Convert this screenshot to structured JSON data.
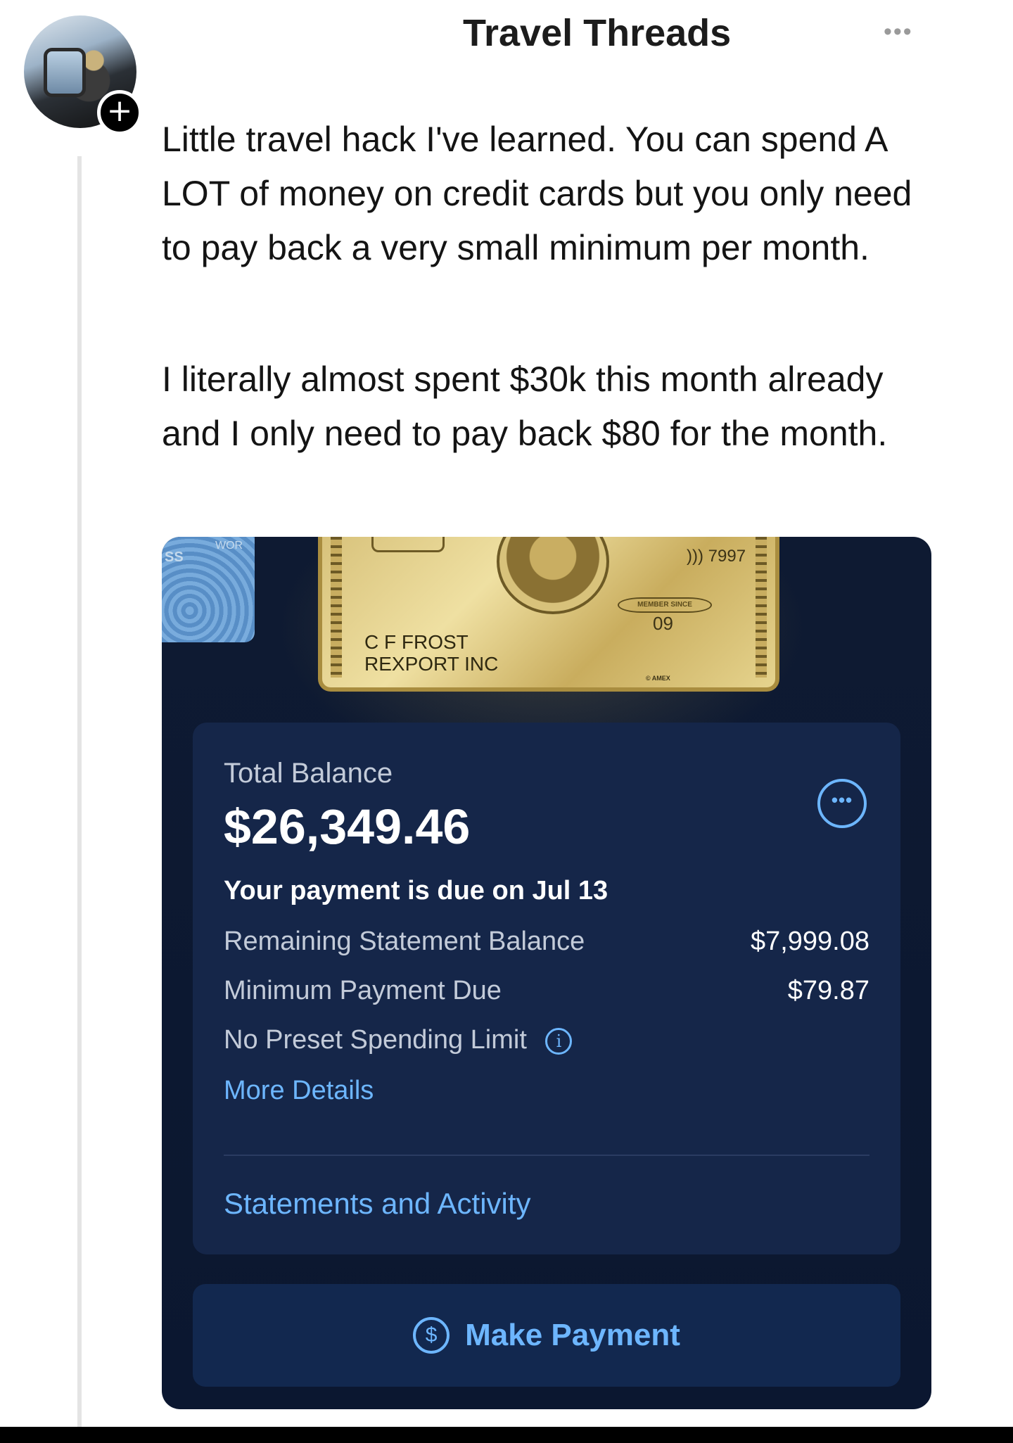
{
  "header": {
    "title": "Travel Threads",
    "follow_symbol": "+",
    "more_symbol": "•••"
  },
  "post": {
    "paragraph_1": "Little travel hack I've learned. You can spend A LOT of money on credit cards but you only need to pay back a very small minimum per month.",
    "paragraph_2": "I literally almost spent $30k this month already and I only need to pay back $80 for the month."
  },
  "card": {
    "contactless_number": "))) 7997",
    "member_since_label": "MEMBER SINCE",
    "member_year": "09",
    "holder_line_1": "C F FROST",
    "holder_line_2": "REXPORT INC",
    "brand_small": "© AMEX",
    "side_card_text": "SS",
    "side_card_text_2": "WOR"
  },
  "account": {
    "total_label": "Total Balance",
    "total_amount": "$26,349.46",
    "options_symbol": "•••",
    "due_text": "Your payment is due on Jul 13",
    "rows": [
      {
        "label": "Remaining Statement Balance",
        "value": "$7,999.08"
      },
      {
        "label": "Minimum Payment Due",
        "value": "$79.87"
      },
      {
        "label": "No Preset Spending Limit",
        "value": ""
      }
    ],
    "info_symbol": "i",
    "more_details_link": "More Details",
    "statements_link": "Statements and Activity",
    "pay_button_icon": "$",
    "pay_button_label": "Make Payment"
  },
  "colors": {
    "accent": "#6db6ff",
    "panel": "#152649",
    "background_dark": "#0e1a32",
    "gold": "#d8c27b"
  },
  "icons": [
    "avatar-photo",
    "plus-icon",
    "more-dots-icon",
    "options-icon",
    "info-icon",
    "dollar-icon"
  ]
}
